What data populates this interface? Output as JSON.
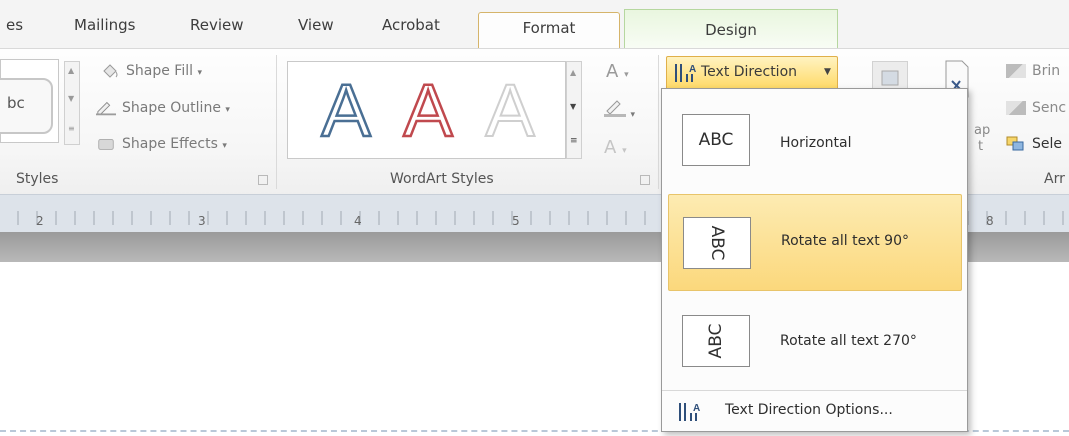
{
  "tabs": {
    "mailings_partial": "es",
    "mailings": "Mailings",
    "review": "Review",
    "view": "View",
    "acrobat": "Acrobat",
    "format": "Format",
    "design": "Design"
  },
  "ribbon": {
    "shape_styles": {
      "thumb_label": "bc",
      "group_label": "Styles",
      "shape_fill": "Shape Fill",
      "shape_outline": "Shape Outline",
      "shape_effects": "Shape Effects"
    },
    "wordart": {
      "group_label": "WordArt Styles",
      "samples": [
        "A",
        "A",
        "A"
      ]
    },
    "text": {
      "text_direction": "Text Direction"
    },
    "partial": {
      "wrap_text_a": "ap",
      "wrap_text_b": "t",
      "bring": "Brin",
      "send": "Senc",
      "select": "Sele",
      "arrange_label": "Arr"
    }
  },
  "ruler": {
    "marks": [
      "2",
      "3",
      "4",
      "5",
      "8"
    ]
  },
  "text_direction_menu": {
    "items": [
      {
        "thumb": "ABC",
        "label": "Horizontal"
      },
      {
        "thumb": "ABC",
        "label": "Rotate all text 90°"
      },
      {
        "thumb": "ABC",
        "label": "Rotate all text 270°"
      }
    ],
    "options_label": "Text Direction Options...",
    "highlighted_index": 1
  },
  "colors": {
    "highlight": "#fbd87c",
    "design_tab": "#e9f6df",
    "ruler": "#dde3ea"
  }
}
